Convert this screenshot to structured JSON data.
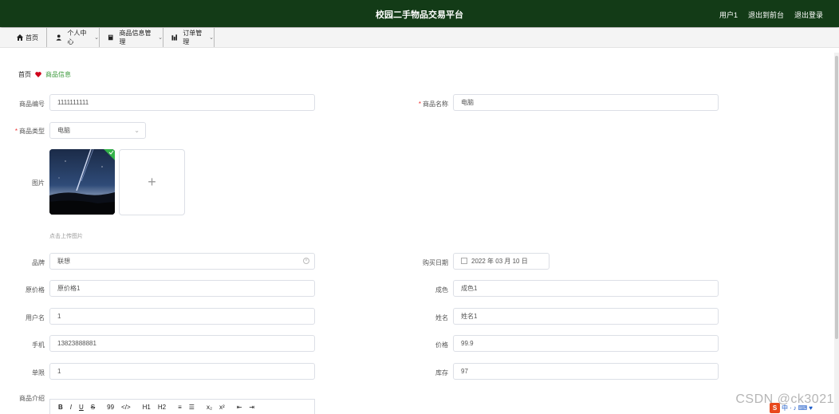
{
  "header": {
    "title": "校园二手物品交易平台",
    "user": "用户1",
    "back_to_front": "退出到前台",
    "logout": "退出登录"
  },
  "nav": {
    "home": "首页",
    "personal": "个人中心",
    "goods_manage": "商品信息管理",
    "order_manage": "订单管理"
  },
  "breadcrumb": {
    "home": "首页",
    "current": "商品信息"
  },
  "form": {
    "goods_no": {
      "label": "商品编号",
      "value": "1111111111"
    },
    "goods_name": {
      "label": "商品名称",
      "value": "电脑"
    },
    "goods_type": {
      "label": "商品类型",
      "value": "电脑"
    },
    "image": {
      "label": "图片",
      "hint": "点击上传图片"
    },
    "brand": {
      "label": "品牌",
      "value": "联想"
    },
    "purchase_date": {
      "label": "购买日期",
      "value": "2022 年 03 月 10 日"
    },
    "original_price": {
      "label": "原价格",
      "value": "原价格1"
    },
    "condition": {
      "label": "成色",
      "value": "成色1"
    },
    "username": {
      "label": "用户名",
      "value": "1"
    },
    "name": {
      "label": "姓名",
      "value": "姓名1"
    },
    "phone": {
      "label": "手机",
      "value": "13823888881"
    },
    "price": {
      "label": "价格",
      "value": "99.9"
    },
    "per_limit": {
      "label": "单限",
      "value": "1"
    },
    "stock": {
      "label": "库存",
      "value": "97"
    },
    "intro": {
      "label": "商品介绍"
    }
  },
  "editor_toolbar": [
    "B",
    "I",
    "U",
    "S",
    "99",
    "</>",
    "H1",
    "H2",
    "≡",
    "☰",
    "x₂",
    "x²",
    "⇤",
    "⇥"
  ],
  "watermark": "CSDN @ck3021",
  "ime": {
    "logo": "S",
    "items": [
      "中",
      "·",
      "♪",
      "⌨",
      "♥"
    ]
  },
  "colors": {
    "header_bg": "#133b17",
    "accent": "#3c9a3c",
    "required": "#e33333"
  }
}
